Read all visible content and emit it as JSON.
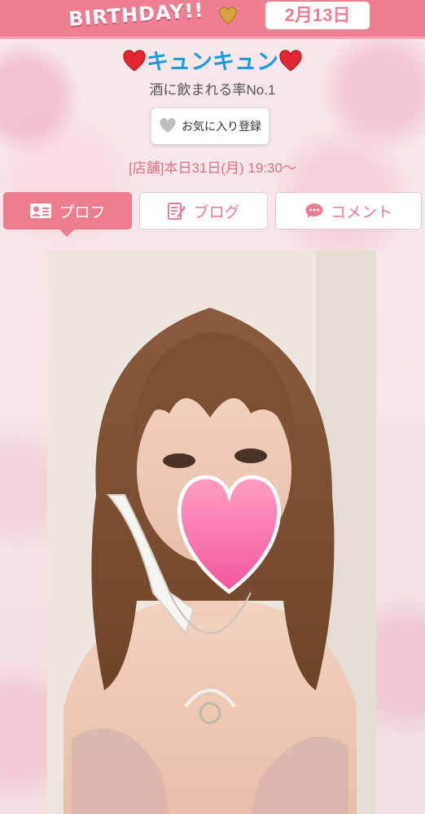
{
  "banner": {
    "birthday_text": "BIRTHDAY!!",
    "date": "2月13日",
    "color": "#ee7f93"
  },
  "profile": {
    "name": "キュンキュン",
    "name_color": "#1e9bd8",
    "tagline": "酒に飲まれる率No.1",
    "favorite_label": "お気に入り登録",
    "schedule": "[店舗]本日31日(月) 19:30〜"
  },
  "tabs": [
    {
      "label": "プロフ",
      "icon": "profile-card-icon",
      "active": true
    },
    {
      "label": "ブログ",
      "icon": "blog-pen-icon",
      "active": false
    },
    {
      "label": "コメント",
      "icon": "speech-bubble-icon",
      "active": false
    }
  ],
  "photo": {
    "icon": "heart-sticker-icon"
  }
}
